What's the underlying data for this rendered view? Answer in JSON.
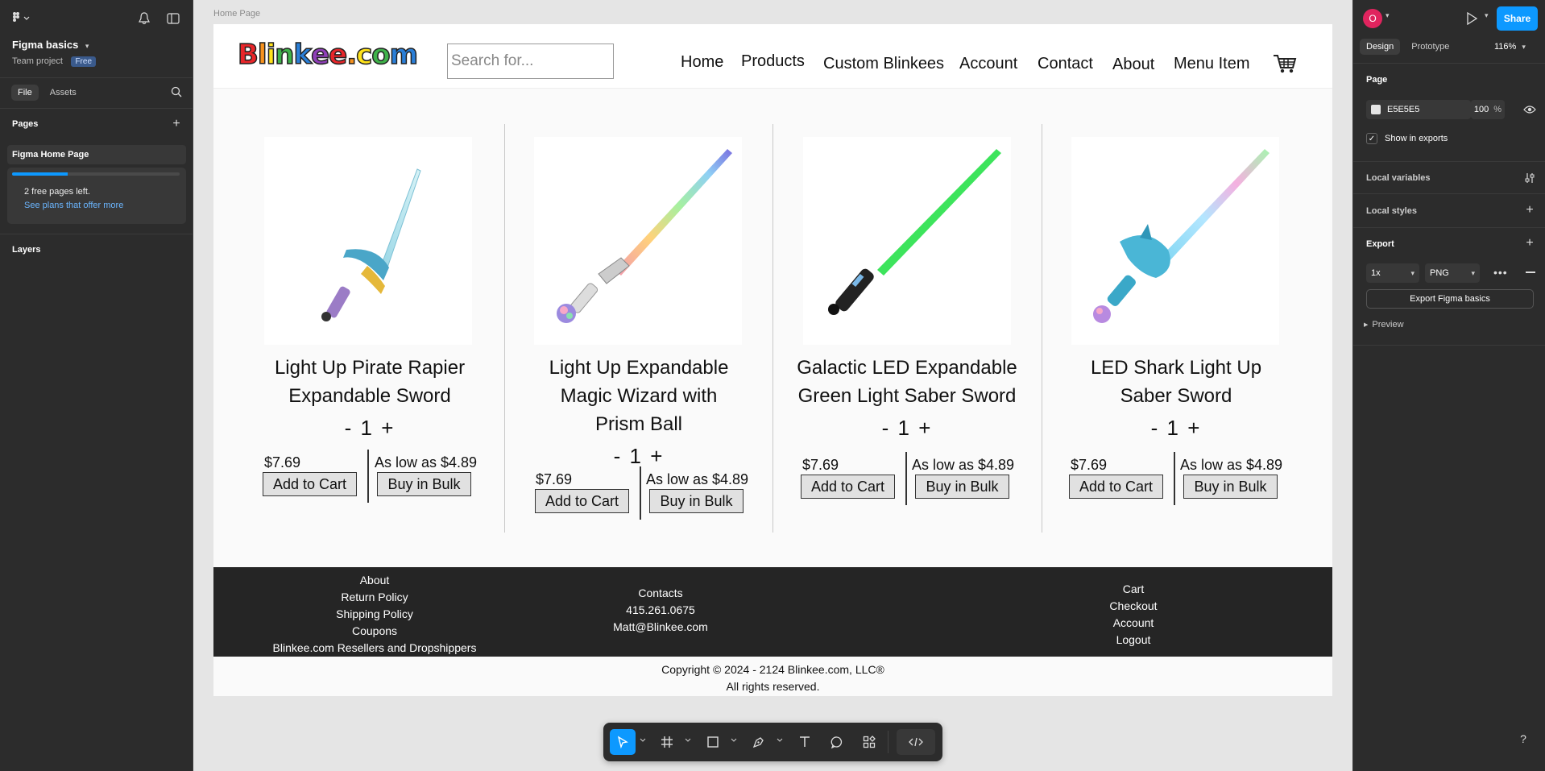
{
  "left_panel": {
    "file_name": "Figma basics",
    "team": "Team project",
    "plan_badge": "Free",
    "tabs": [
      "File",
      "Assets"
    ],
    "pages_title": "Pages",
    "current_page": "Figma Home Page",
    "notice": {
      "text": "2 free pages left.",
      "link": "See plans that offer more",
      "progress": 0.33
    },
    "layers_title": "Layers"
  },
  "right_panel": {
    "avatar_letter": "O",
    "share_label": "Share",
    "tabs": [
      "Design",
      "Prototype"
    ],
    "zoom": "116%",
    "page_section": "Page",
    "page_color": "E5E5E5",
    "page_opacity": "100",
    "percent_sign": "%",
    "show_in_exports": "Show in exports",
    "local_variables": "Local variables",
    "local_styles": "Local styles",
    "export_title": "Export",
    "export_scale": "1x",
    "export_format": "PNG",
    "export_button": "Export Figma basics",
    "preview": "Preview"
  },
  "canvas": {
    "frame_label": "Home Page",
    "site": {
      "logo_letters": [
        "B",
        "l",
        "i",
        "n",
        "k",
        "e",
        "e",
        ".",
        "c",
        "o",
        "m"
      ],
      "logo_colors": [
        "#e8262a",
        "#f7921e",
        "#ffe21a",
        "#3fb24a",
        "#2a7fd8",
        "#8f3fb8",
        "#e8262a",
        "#f7921e",
        "#ffe21a",
        "#3fb24a",
        "#2a7fd8"
      ],
      "search_placeholder": "Search for...",
      "nav": [
        "Home",
        "Products",
        "Custom Blinkees",
        "Account",
        "Contact",
        "About",
        "Menu Item"
      ],
      "products": [
        {
          "title_lines": [
            "Light Up Pirate Rapier",
            "Expandable Sword"
          ],
          "qty": "1",
          "price": "$7.69",
          "bulk": "As low as $4.89",
          "add": "Add to Cart",
          "buy": "Buy in Bulk"
        },
        {
          "title_lines": [
            "Light Up Expandable",
            "Magic Wizard with",
            "Prism Ball"
          ],
          "qty": "1",
          "price": "$7.69",
          "bulk": "As low as $4.89",
          "add": "Add to Cart",
          "buy": "Buy in Bulk"
        },
        {
          "title_lines": [
            "Galactic LED Expandable",
            "Green Light Saber Sword"
          ],
          "qty": "1",
          "price": "$7.69",
          "bulk": "As low as $4.89",
          "add": "Add to Cart",
          "buy": "Buy in Bulk"
        },
        {
          "title_lines": [
            "LED Shark Light Up",
            "Saber Sword"
          ],
          "qty": "1",
          "price": "$7.69",
          "bulk": "As low as $4.89",
          "add": "Add to Cart",
          "buy": "Buy in Bulk"
        }
      ],
      "footer": {
        "col1": [
          "About",
          "Return Policy",
          "Shipping Policy",
          "Coupons",
          "Blinkee.com Resellers and Dropshippers"
        ],
        "col2": [
          "Contacts",
          "415.261.0675",
          "Matt@Blinkee.com"
        ],
        "col3": [
          "Cart",
          "Checkout",
          "Account",
          "Logout"
        ]
      },
      "copyright": [
        "Copyright © 2024 - 2124 Blinkee.com, LLC®",
        "All rights reserved."
      ]
    }
  },
  "toolbar": {
    "tools": [
      "move-tool",
      "frame-tool",
      "shape-tool",
      "pen-tool",
      "text-tool",
      "comment-tool",
      "actions-tool",
      "dev-mode-toggle"
    ]
  },
  "help_label": "?"
}
